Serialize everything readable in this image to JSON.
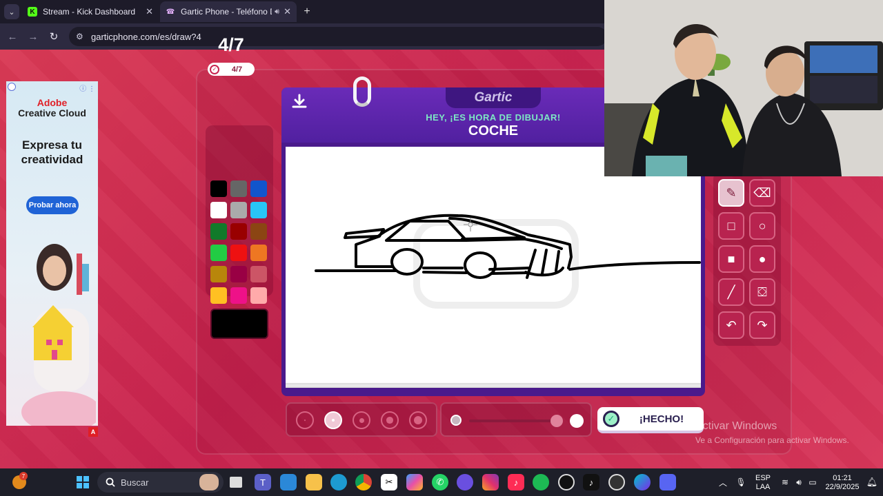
{
  "browser": {
    "tabs": [
      {
        "title": "Stream - Kick Dashboard",
        "icon": "kick-icon",
        "active": false
      },
      {
        "title": "Gartic Phone - Teléfono Des",
        "icon": "phone-icon",
        "active": true
      }
    ],
    "url": "garticphone.com/es/draw?4",
    "new_tab": "+"
  },
  "ad": {
    "brand_line1": "Adobe",
    "brand_line2": "Creative Cloud",
    "tagline_line1": "Expresa tu",
    "tagline_line2": "creatividad",
    "cta": "Probar ahora",
    "corner_badge": "A"
  },
  "game": {
    "round": "4/7",
    "round_badge": "4/7",
    "logo": "Gartic",
    "hint": "HEY, ¡ES HORA DE DIBUJAR!",
    "word": "COCHE",
    "done_label": "¡HECHO!",
    "current_color": "#000000",
    "palette": [
      "#000000",
      "#666666",
      "#1155cc",
      "#ffffff",
      "#aaaaaa",
      "#29c5f6",
      "#117a2a",
      "#990000",
      "#8b4513",
      "#22cc44",
      "#ee1111",
      "#ee7722",
      "#b8860b",
      "#990044",
      "#cc5566",
      "#ffc022",
      "#ee1188",
      "#ffaaaa"
    ],
    "tools": [
      "pencil-icon",
      "eraser-icon",
      "square-outline-icon",
      "circle-outline-icon",
      "square-fill-icon",
      "circle-fill-icon",
      "line-icon",
      "bucket-icon",
      "undo-icon",
      "redo-icon"
    ],
    "brush_sizes": 5,
    "selected_brush_index": 1,
    "opacity_level": 1.0
  },
  "windows_watermark": {
    "title": "Activar Windows",
    "subtitle": "Ve a Configuración para activar Windows."
  },
  "taskbar": {
    "search_label": "Buscar",
    "notification_badge": "7",
    "language_line1": "ESP",
    "language_line2": "LAA",
    "time": "01:21",
    "date": "22/9/2025"
  }
}
